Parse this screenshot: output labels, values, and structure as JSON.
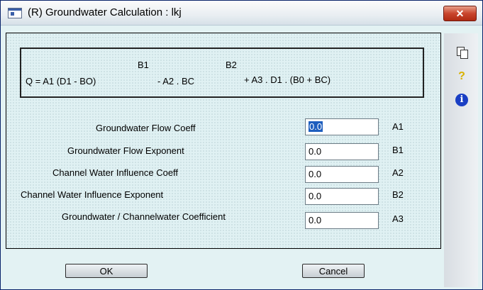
{
  "window": {
    "title": "(R) Groundwater Calculation : lkj",
    "close_label": "✕"
  },
  "sidebar": {
    "icons": [
      "copy-icon",
      "help-icon",
      "info-icon"
    ],
    "help_glyph": "?",
    "info_glyph": "i"
  },
  "formula": {
    "main": "Q = A1 (D1 - BO)",
    "exp1": "B1",
    "part2": "- A2 . BC",
    "exp2": "B2",
    "part3": "+ A3 . D1 . (B0 + BC)"
  },
  "fields": [
    {
      "label": "Groundwater Flow Coeff",
      "value": "0.0",
      "param": "A1"
    },
    {
      "label": "Groundwater Flow Exponent",
      "value": "0.0",
      "param": "B1"
    },
    {
      "label": "Channel Water Influence Coeff",
      "value": "0.0",
      "param": "A2"
    },
    {
      "label": "Channel Water Influence Exponent",
      "value": "0.0",
      "param": "B2"
    },
    {
      "label": "Groundwater / Channelwater Coefficient",
      "value": "0.0",
      "param": "A3"
    }
  ],
  "buttons": {
    "ok": "OK",
    "cancel": "Cancel"
  }
}
